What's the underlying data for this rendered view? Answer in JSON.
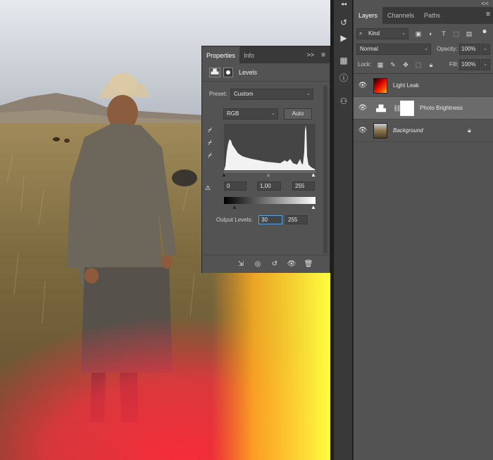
{
  "properties_panel": {
    "tabs": [
      {
        "label": "Properties"
      },
      {
        "label": "Info"
      }
    ],
    "expand_glyph": ">>",
    "menu_glyph": "≡",
    "adjustment_title": "Levels",
    "preset_label": "Preset:",
    "preset_value": "Custom",
    "channel_value": "RGB",
    "auto_label": "Auto",
    "input_levels": {
      "black": "0",
      "gamma": "1,00",
      "white": "255"
    },
    "output_levels_label": "Output Levels:",
    "output_levels": {
      "black": "30",
      "white": "255"
    }
  },
  "layers_panel": {
    "collapse_glyph": "<<",
    "tabs": [
      {
        "label": "Layers"
      },
      {
        "label": "Channels"
      },
      {
        "label": "Paths"
      }
    ],
    "menu_glyph": "≡",
    "filter_kind": "Kind",
    "blend_mode": "Normal",
    "opacity_label": "Opacity:",
    "opacity_value": "100%",
    "lock_label": "Lock:",
    "fill_label": "Fill:",
    "fill_value": "100%",
    "layers": [
      {
        "name": "Light Leak"
      },
      {
        "name": "Photo Brightness"
      },
      {
        "name": "Background"
      }
    ]
  },
  "colors": {
    "panel_bg": "#535353",
    "tab_bar_bg": "#393939",
    "selected_layer": "#6b6b6b"
  },
  "icons": [
    "search-icon",
    "image-filter-icon",
    "circle-filter-icon",
    "type-filter-icon",
    "shape-filter-icon",
    "smart-object-filter-icon",
    "toggle-filter-icon",
    "lock-pixels-icon",
    "lock-paint-icon",
    "lock-move-icon",
    "lock-artboard-icon",
    "lock-all-icon",
    "eye-icon",
    "chain-icon",
    "lock-icon",
    "levels-icon",
    "mask-icon",
    "eyedropper-black-icon",
    "eyedropper-gray-icon",
    "eyedropper-white-icon",
    "warning-icon",
    "clip-to-layer-icon",
    "view-previous-icon",
    "reset-icon",
    "visibility-icon",
    "trash-icon",
    "history-icon",
    "play-icon",
    "adjustments-icon",
    "info-icon",
    "libraries-icon"
  ]
}
